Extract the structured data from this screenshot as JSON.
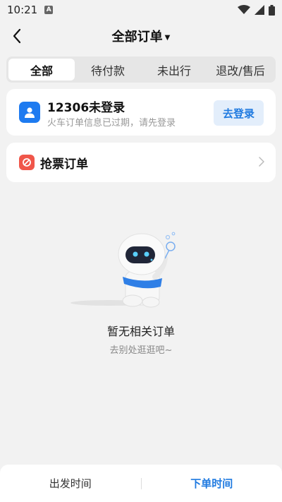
{
  "status_bar": {
    "time": "10:21",
    "notification_icon": "a-notification-icon",
    "wifi_icon": "wifi-icon",
    "signal_icon": "signal-icon",
    "battery_icon": "battery-icon"
  },
  "header": {
    "title": "全部订单",
    "back_icon": "back-arrow-icon",
    "dropdown_icon": "caret-down-icon"
  },
  "tabs": [
    {
      "label": "全部",
      "active": true
    },
    {
      "label": "待付款",
      "active": false
    },
    {
      "label": "未出行",
      "active": false
    },
    {
      "label": "退改/售后",
      "active": false
    }
  ],
  "login_card": {
    "title": "12306未登录",
    "subtitle": "火车订单信息已过期，请先登录",
    "button_label": "去登录",
    "icon": "user-icon"
  },
  "grab_card": {
    "title": "抢票订单",
    "icon": "ticket-grab-icon"
  },
  "empty_state": {
    "title": "暂无相关订单",
    "subtitle": "去别处逛逛吧~",
    "illustration": "robot-blowing-bubbles"
  },
  "bottom_bar": {
    "left_label": "出发时间",
    "right_label": "下单时间",
    "active": "right"
  },
  "colors": {
    "accent": "#1f7ae0",
    "background": "#f2f2f2",
    "grab_icon": "#f0564a"
  }
}
